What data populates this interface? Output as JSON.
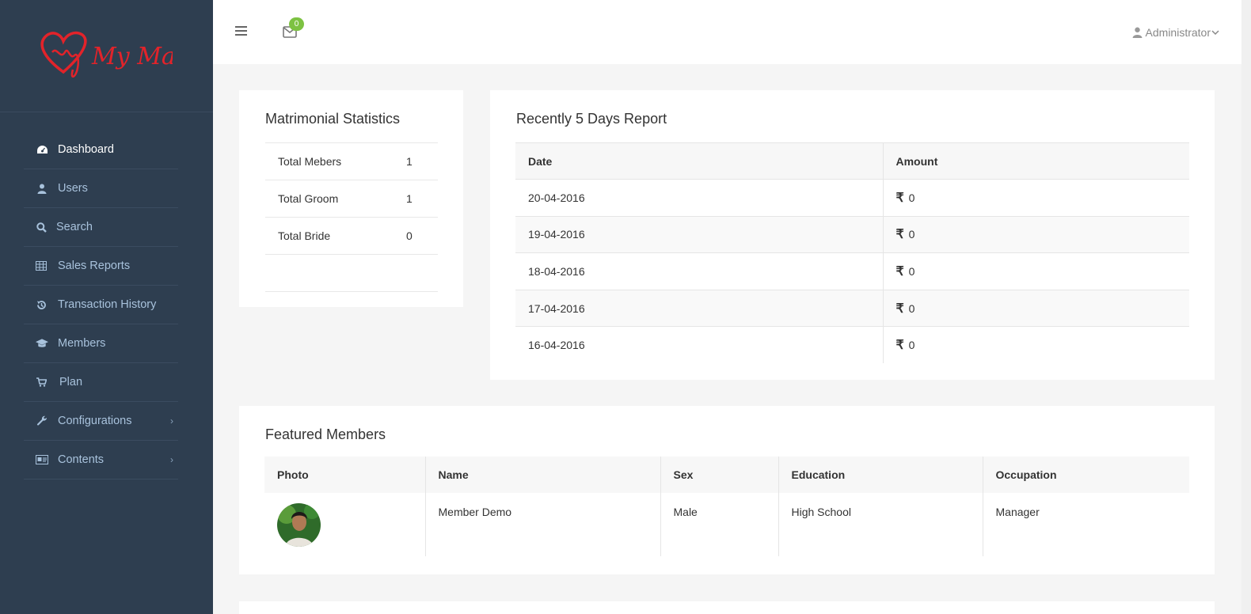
{
  "brand": {
    "logo_text": "My Matri",
    "logo_color": "#e2232a"
  },
  "sidebar": {
    "items": [
      {
        "label": "Dashboard",
        "icon": "dashboard-icon",
        "active": true
      },
      {
        "label": "Users",
        "icon": "user-icon"
      },
      {
        "label": "Search",
        "icon": "search-icon"
      },
      {
        "label": "Sales Reports",
        "icon": "table-icon"
      },
      {
        "label": "Transaction History",
        "icon": "history-icon"
      },
      {
        "label": "Members",
        "icon": "graduation-cap-icon"
      },
      {
        "label": "Plan",
        "icon": "cart-icon"
      },
      {
        "label": "Configurations",
        "icon": "wrench-icon",
        "has_children": true
      },
      {
        "label": "Contents",
        "icon": "id-card-icon",
        "has_children": true
      }
    ]
  },
  "topbar": {
    "mail_count": "0",
    "user_label": "Administrator"
  },
  "stats": {
    "title": "Matrimonial Statistics",
    "rows": [
      {
        "label": "Total Mebers",
        "value": "1"
      },
      {
        "label": "Total Groom",
        "value": "1"
      },
      {
        "label": "Total Bride",
        "value": "0"
      }
    ]
  },
  "report": {
    "title": "Recently 5 Days Report",
    "columns": [
      "Date",
      "Amount"
    ],
    "currency": "₹",
    "rows": [
      {
        "date": "20-04-2016",
        "amount": "0"
      },
      {
        "date": "19-04-2016",
        "amount": "0"
      },
      {
        "date": "18-04-2016",
        "amount": "0"
      },
      {
        "date": "17-04-2016",
        "amount": "0"
      },
      {
        "date": "16-04-2016",
        "amount": "0"
      }
    ]
  },
  "featured": {
    "title": "Featured Members",
    "columns": [
      "Photo",
      "Name",
      "Sex",
      "Education",
      "Occupation"
    ],
    "rows": [
      {
        "name": "Member Demo",
        "sex": "Male",
        "education": "High School",
        "occupation": "Manager"
      }
    ]
  }
}
